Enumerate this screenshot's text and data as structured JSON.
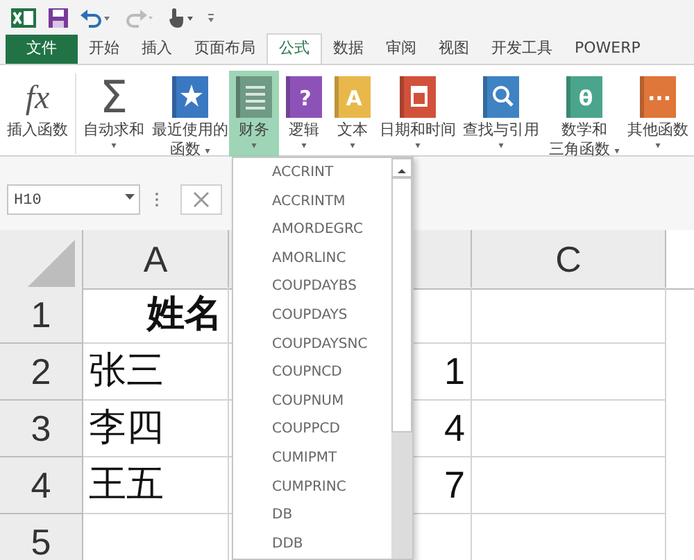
{
  "tabs": [
    {
      "label": "文件",
      "kind": "file",
      "selected": false
    },
    {
      "label": "开始",
      "kind": "tab",
      "selected": false
    },
    {
      "label": "插入",
      "kind": "tab",
      "selected": false
    },
    {
      "label": "页面布局",
      "kind": "tab",
      "selected": false
    },
    {
      "label": "公式",
      "kind": "tab",
      "selected": true
    },
    {
      "label": "数据",
      "kind": "tab",
      "selected": false
    },
    {
      "label": "审阅",
      "kind": "tab",
      "selected": false
    },
    {
      "label": "视图",
      "kind": "tab",
      "selected": false
    },
    {
      "label": "开发工具",
      "kind": "tab",
      "selected": false
    },
    {
      "label": "POWERP",
      "kind": "tab",
      "selected": false
    }
  ],
  "ribbon": [
    {
      "lines": [
        "插入函数"
      ],
      "kind": "fx",
      "glyph": "fx",
      "selected": false
    },
    {
      "lines": [
        "自动求和"
      ],
      "kind": "sigma",
      "glyph": "Σ",
      "caret": "▾",
      "selected": false
    },
    {
      "lines": [
        "最近使用的",
        "函数"
      ],
      "kind": "star",
      "color": "#3a78c2",
      "caret": "▾",
      "selected": false
    },
    {
      "lines": [
        "财务"
      ],
      "kind": "lines",
      "color": "#6f9a84",
      "caret": "▾",
      "selected": true
    },
    {
      "lines": [
        "逻辑"
      ],
      "kind": "glyph",
      "glyph": "?",
      "color": "#8d52b8",
      "caret": "▾",
      "selected": false
    },
    {
      "lines": [
        "文本"
      ],
      "kind": "glyph",
      "glyph": "A",
      "color": "#e8b84a",
      "caret": "▾",
      "selected": false
    },
    {
      "lines": [
        "日期和时间"
      ],
      "kind": "calendar",
      "color": "#d2513a",
      "caret": "▾",
      "selected": false
    },
    {
      "lines": [
        "查找与引用"
      ],
      "kind": "magnifier",
      "color": "#3f83c4",
      "caret": "▾",
      "selected": false
    },
    {
      "lines": [
        "数学和",
        "三角函数"
      ],
      "kind": "glyph",
      "glyph": "θ",
      "color": "#4aa58c",
      "caret": "▾",
      "selected": false
    },
    {
      "lines": [
        "其他函数"
      ],
      "kind": "glyph",
      "glyph": "···",
      "color": "#e0763a",
      "caret": "▾",
      "selected": false
    }
  ],
  "name_box": "H10",
  "grid": {
    "column_headers": [
      "A",
      "C"
    ],
    "rows": [
      {
        "header": "1",
        "kind": "heading",
        "cells": [
          "姓名"
        ]
      },
      {
        "header": "2",
        "kind": "data",
        "cells": [
          "张三",
          "1"
        ]
      },
      {
        "header": "3",
        "kind": "data",
        "cells": [
          "李四",
          "4"
        ]
      },
      {
        "header": "4",
        "kind": "data",
        "cells": [
          "王五",
          "7"
        ]
      },
      {
        "header": "5",
        "kind": "data"
      }
    ]
  },
  "function_list": [
    "ACCRINT",
    "ACCRINTM",
    "AMORDEGRC",
    "AMORLINC",
    "COUPDAYBS",
    "COUPDAYS",
    "COUPDAYSNC",
    "COUPNCD",
    "COUPNUM",
    "COUPPCD",
    "CUMIPMT",
    "CUMPRINC",
    "DB",
    "DDB"
  ]
}
